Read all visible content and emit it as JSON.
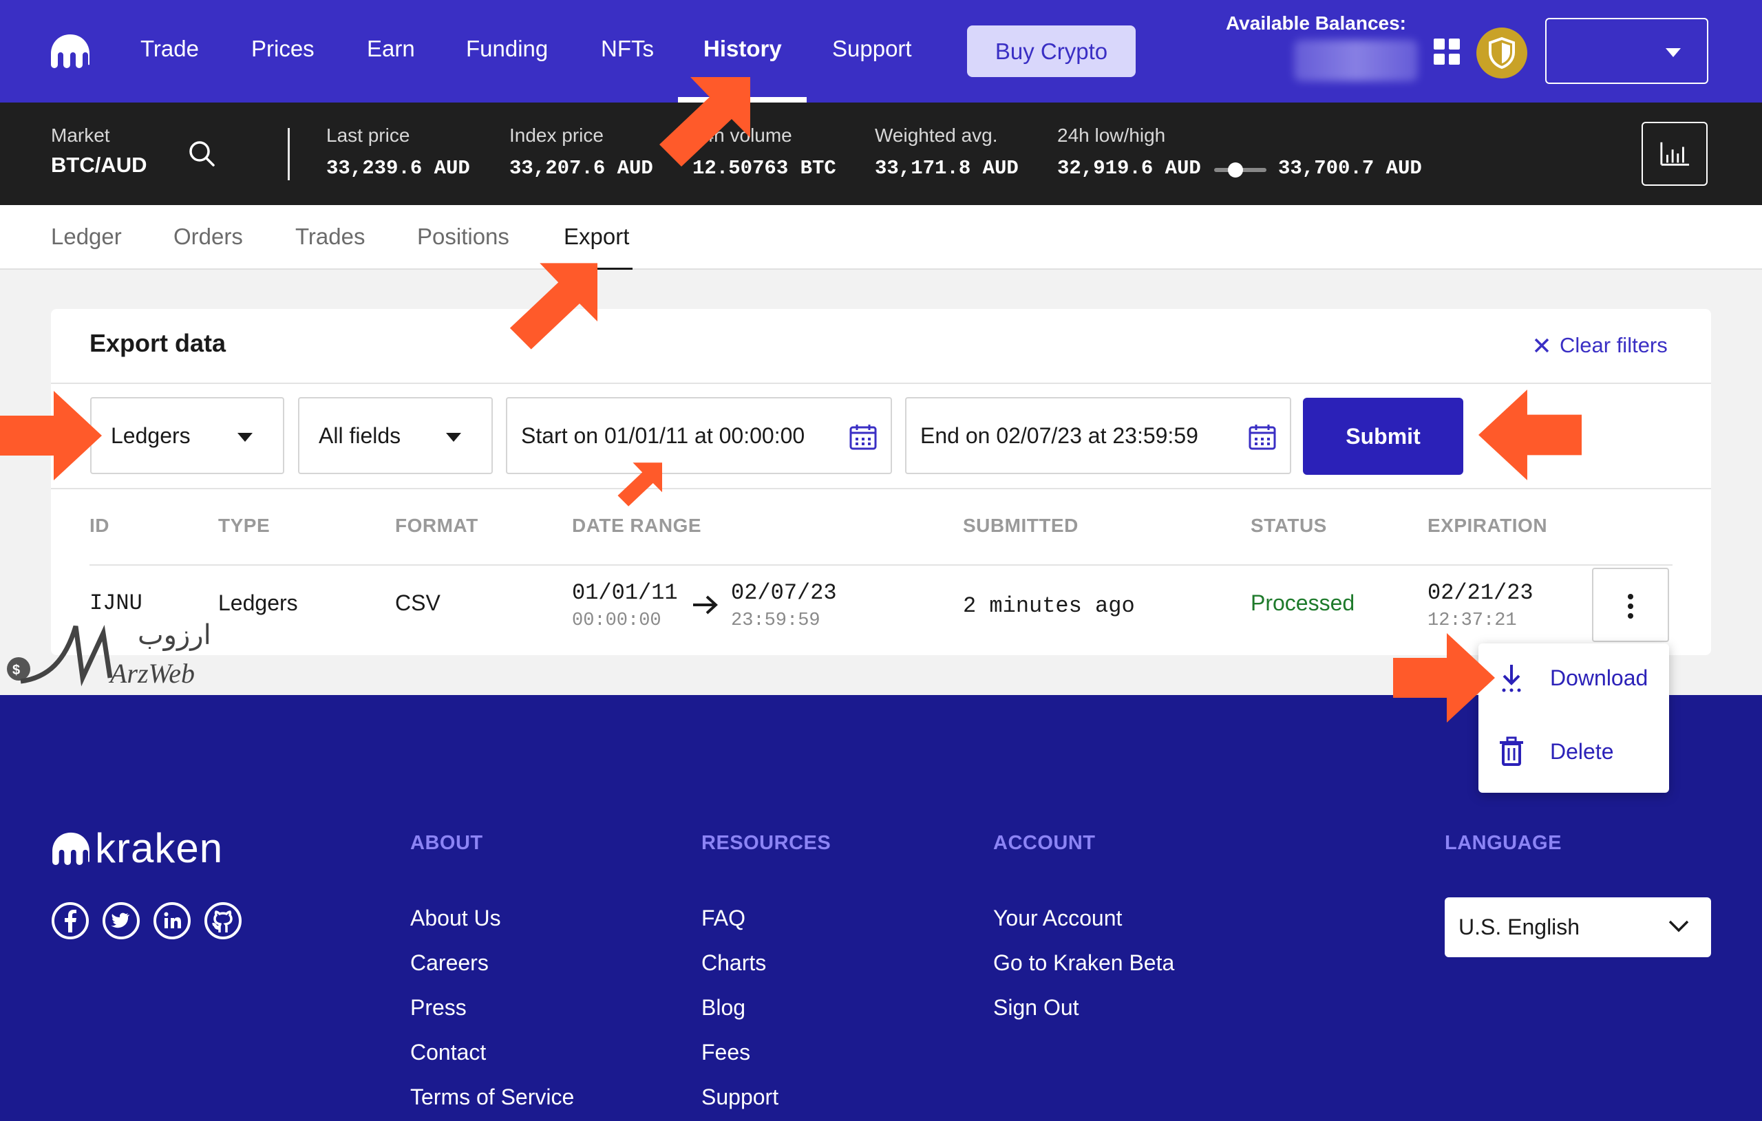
{
  "nav": {
    "items": [
      "Trade",
      "Prices",
      "Earn",
      "Funding",
      "NFTs",
      "History",
      "Support"
    ],
    "active": "History",
    "buy_label": "Buy Crypto",
    "balances_label": "Available Balances:"
  },
  "ticker": {
    "market_label": "Market",
    "market_value": "BTC/AUD",
    "last_label": "Last price",
    "last_value": "33,239.6 AUD",
    "index_label": "Index price",
    "index_value": "33,207.6 AUD",
    "volume_label": "24h volume",
    "volume_value": "12.50763 BTC",
    "wavg_label": "Weighted avg.",
    "wavg_value": "33,171.8 AUD",
    "range_label": "24h low/high",
    "low_value": "32,919.6 AUD",
    "high_value": "33,700.7 AUD"
  },
  "subtabs": {
    "items": [
      "Ledger",
      "Orders",
      "Trades",
      "Positions",
      "Export"
    ],
    "active": "Export"
  },
  "export": {
    "title": "Export data",
    "clear_label": "Clear filters",
    "type_select": "Ledgers",
    "fields_select": "All fields",
    "start": "Start on 01/01/11 at 00:00:00",
    "end": "End on 02/07/23 at 23:59:59",
    "submit_label": "Submit",
    "headers": [
      "ID",
      "TYPE",
      "FORMAT",
      "DATE RANGE",
      "SUBMITTED",
      "STATUS",
      "EXPIRATION"
    ],
    "row": {
      "id": "IJNU",
      "type": "Ledgers",
      "format": "CSV",
      "range_start_date": "01/01/11",
      "range_start_time": "00:00:00",
      "range_end_date": "02/07/23",
      "range_end_time": "23:59:59",
      "submitted": "2 minutes ago",
      "status": "Processed",
      "expiration_date": "02/21/23",
      "expiration_time": "12:37:21"
    },
    "menu": {
      "download": "Download",
      "delete": "Delete"
    }
  },
  "footer": {
    "logo_text": "kraken",
    "social_icons": [
      "facebook-icon",
      "twitter-icon",
      "linkedin-icon",
      "github-icon"
    ],
    "about": {
      "heading": "ABOUT",
      "links": [
        "About Us",
        "Careers",
        "Press",
        "Contact",
        "Terms of Service"
      ]
    },
    "resources": {
      "heading": "RESOURCES",
      "links": [
        "FAQ",
        "Charts",
        "Blog",
        "Fees",
        "Support"
      ]
    },
    "account": {
      "heading": "ACCOUNT",
      "links": [
        "Your Account",
        "Go to Kraken Beta",
        "Sign Out"
      ]
    },
    "language": {
      "heading": "LANGUAGE",
      "value": "U.S. English"
    }
  },
  "watermark": {
    "text_fa": "ارزوب",
    "text_en": "ArzWeb"
  },
  "colors": {
    "brand": "#3a2fc4",
    "annotation": "#ff5a2a",
    "status_ok": "#1e7a2b",
    "footer_bg": "#1b1a8f"
  }
}
